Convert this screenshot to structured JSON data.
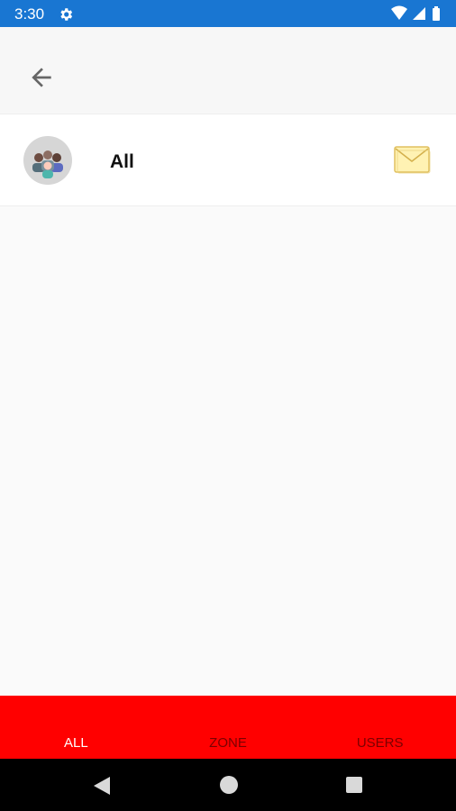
{
  "status_bar": {
    "time": "3:30",
    "icons": [
      "gear-icon",
      "wifi-icon",
      "signal-icon",
      "battery-icon"
    ]
  },
  "app_bar": {
    "back_icon": "arrow-left-icon"
  },
  "list": {
    "items": [
      {
        "label": "All",
        "avatar": "group-avatar",
        "trailing_icon": "mail-icon"
      }
    ]
  },
  "bottom_tabs": {
    "tabs": [
      {
        "label": "ALL",
        "active": true
      },
      {
        "label": "ZONE",
        "active": false
      },
      {
        "label": "USERS",
        "active": false
      }
    ]
  },
  "nav_bar": {
    "icons": [
      "back-triangle-icon",
      "home-circle-icon",
      "recents-square-icon"
    ]
  },
  "colors": {
    "status_bar": "#1976d2",
    "tab_bar": "#ff0000",
    "nav_bar": "#000000"
  }
}
